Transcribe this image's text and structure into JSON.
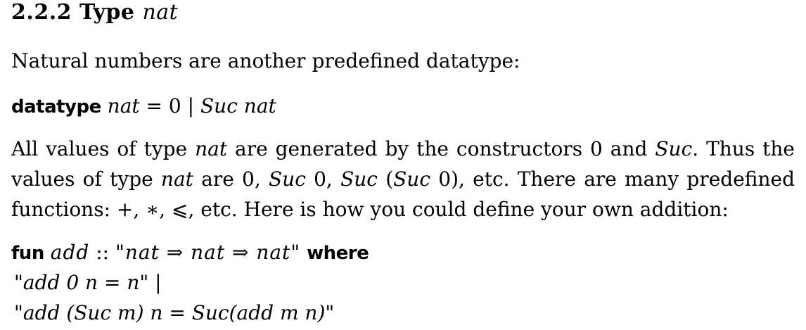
{
  "section": {
    "number": "2.2.2",
    "type_word": "Type",
    "type_name": "nat"
  },
  "intro": "Natural numbers are another predefined datatype:",
  "datatype_decl": {
    "keyword": "datatype",
    "lhs": "nat",
    "eq": " = ",
    "zero": "0",
    "bar": " | ",
    "suc": "Suc",
    "arg": "nat"
  },
  "para": {
    "line1": {
      "a": "All values of type ",
      "b": "nat",
      "c": " are generated by the constructors ",
      "d": "0",
      "e": " and ",
      "f": "Suc",
      "g": ". Thus the"
    },
    "line2": {
      "a": "values of type ",
      "b": "nat",
      "c": " are ",
      "d": "0",
      "e": ", ",
      "f": "Suc",
      "g": " 0, ",
      "h": "Suc",
      "i": " (",
      "j": "Suc",
      "k": " 0), etc. There are many predefined"
    },
    "line3": "functions: +, ∗, ⩽, etc. Here is how you could define your own addition:"
  },
  "fun_decl": {
    "keyword": "fun",
    "name": "add",
    "colons": " :: ",
    "type_sig": "\"nat ⇒ nat ⇒ nat\"",
    "where": "where"
  },
  "equations": [
    "\"add 0 n = n\" |",
    "\"add (Suc m) n = Suc(add m n)\""
  ]
}
